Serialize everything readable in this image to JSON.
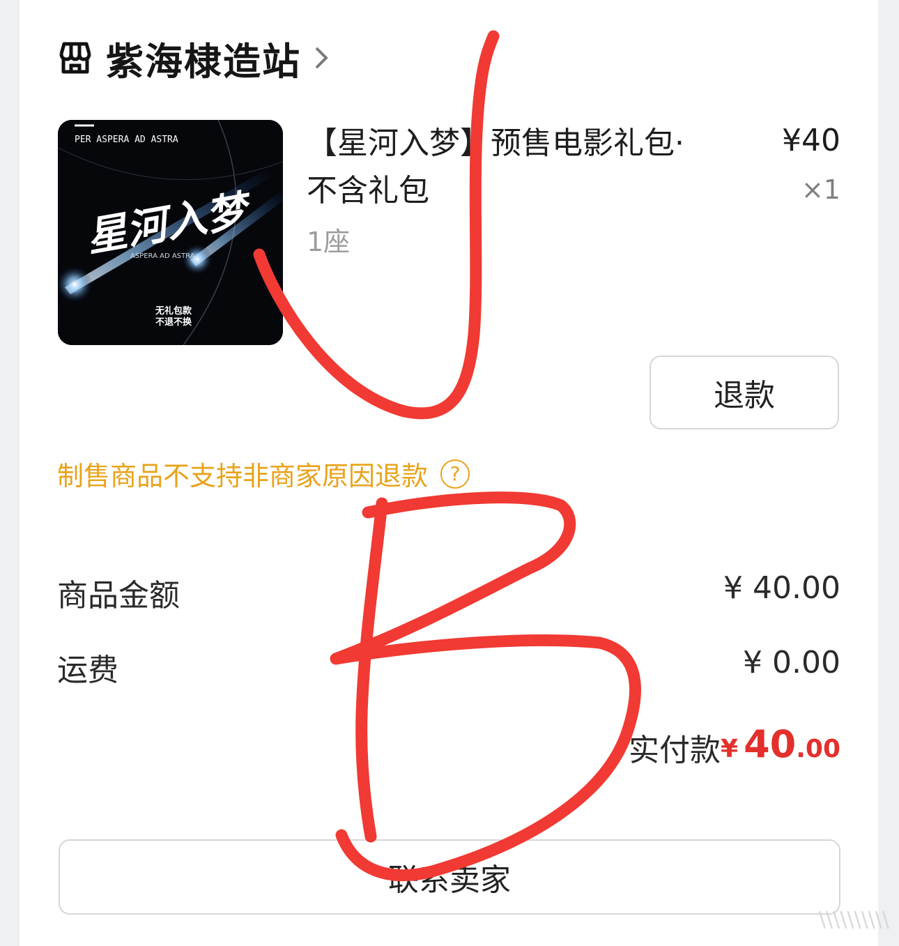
{
  "shop": {
    "name": "紫海棣造站",
    "icon": "store-icon",
    "chevron": "chevron-right-icon"
  },
  "product": {
    "title": "【星河入梦】预售电影礼包·不含礼包",
    "spec": "1座",
    "price": "¥40",
    "quantity": "×1",
    "thumbnail": {
      "top_text": "PER ASPERA AD ASTRA",
      "calligraphy": "星河入梦",
      "sub_text": "ASPERA AD ASTRA",
      "badge_line1": "无礼包款",
      "badge_line2": "不退不换"
    }
  },
  "actions": {
    "refund_label": "退款",
    "contact_label": "联系卖家"
  },
  "notice": {
    "text": "制售商品不支持非商家原因退款",
    "help_symbol": "?"
  },
  "summary": {
    "goods_amount_label": "商品金额",
    "goods_amount_value": "¥ 40.00",
    "shipping_label": "运费",
    "shipping_value": "¥ 0.00",
    "paid_label": "实付款",
    "paid_currency": "¥",
    "paid_integer": "40",
    "paid_decimal": ".00"
  },
  "annotations": {
    "marks": [
      "✓",
      "B"
    ],
    "color": "#f03a33"
  },
  "watermark": "\\\\\\\\\\\\\\\\\\\\",
  "colors": {
    "accent_notice": "#e8a31a",
    "price_red": "#e2302d",
    "border": "#d6d6d6"
  }
}
